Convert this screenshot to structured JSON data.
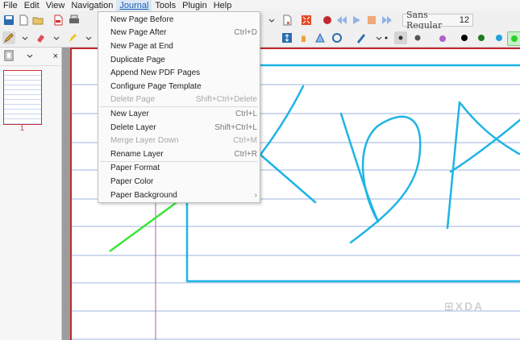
{
  "menubar": {
    "items": [
      "File",
      "Edit",
      "View",
      "Navigation",
      "Journal",
      "Tools",
      "Plugin",
      "Help"
    ],
    "active": "Journal"
  },
  "toolbar": {
    "font_name": "Sans Regular",
    "font_size": "12",
    "accent": "#3b82f6"
  },
  "journal_menu": {
    "items": [
      {
        "label": "New Page Before",
        "shortcut": "",
        "enabled": true
      },
      {
        "label": "New Page After",
        "shortcut": "Ctrl+D",
        "enabled": true
      },
      {
        "label": "New Page at End",
        "shortcut": "",
        "enabled": true
      },
      {
        "label": "Duplicate Page",
        "shortcut": "",
        "enabled": true
      },
      {
        "label": "Append New PDF Pages",
        "shortcut": "",
        "enabled": true
      },
      {
        "label": "Configure Page Template",
        "shortcut": "",
        "enabled": true
      },
      {
        "label": "Delete Page",
        "shortcut": "Shift+Ctrl+Delete",
        "enabled": false
      },
      {
        "label": "New Layer",
        "shortcut": "Ctrl+L",
        "enabled": true
      },
      {
        "label": "Delete Layer",
        "shortcut": "Shift+Ctrl+L",
        "enabled": true
      },
      {
        "label": "Merge Layer Down",
        "shortcut": "Ctrl+M",
        "enabled": false
      },
      {
        "label": "Rename Layer",
        "shortcut": "Ctrl+R",
        "enabled": true
      },
      {
        "label": "Paper Format",
        "shortcut": "",
        "enabled": true
      },
      {
        "label": "Paper Color",
        "shortcut": "",
        "enabled": true
      },
      {
        "label": "Paper Background",
        "shortcut": "›",
        "enabled": true
      }
    ]
  },
  "sidebar": {
    "page_number": "1"
  },
  "colors": {
    "palette": [
      "#000000",
      "#1e7a1e",
      "#22a0e0",
      "#2ad12a"
    ],
    "ink_blue": "#1eb4e6",
    "ink_green": "#39e639",
    "margin_red": "#c0282d",
    "rule_blue": "#9fb4e0"
  },
  "watermark": {
    "text": "⊞XDA"
  }
}
